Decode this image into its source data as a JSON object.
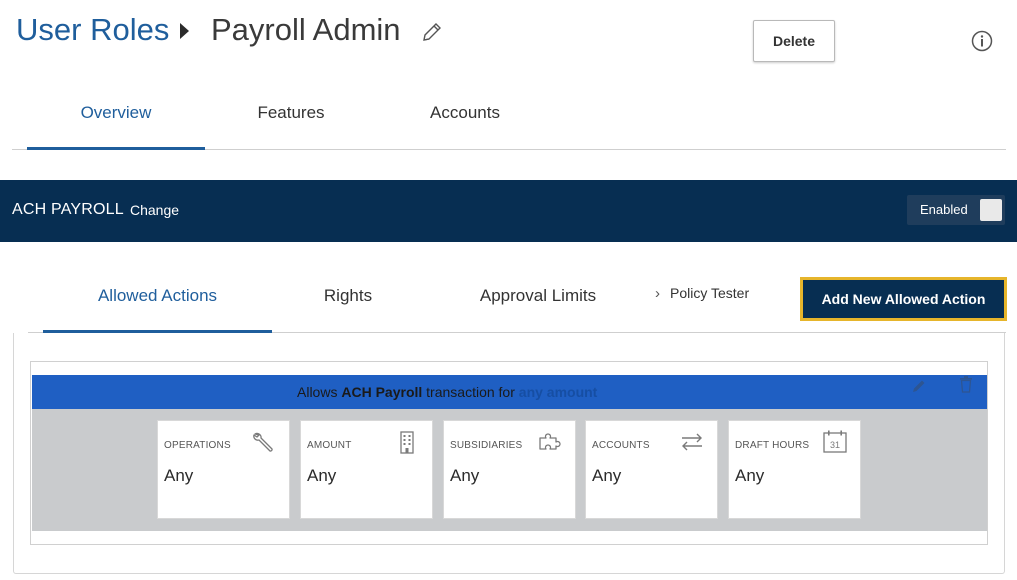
{
  "header": {
    "breadcrumb_root": "User Roles",
    "title": "Payroll Admin",
    "delete_label": "Delete"
  },
  "top_tabs": [
    {
      "label": "Overview",
      "active": true
    },
    {
      "label": "Features",
      "active": false
    },
    {
      "label": "Accounts",
      "active": false
    }
  ],
  "band": {
    "title": "ACH PAYROLL",
    "change_label": "Change",
    "toggle_label": "Enabled"
  },
  "sub_tabs": [
    {
      "label": "Allowed Actions",
      "active": true
    },
    {
      "label": "Rights",
      "active": false
    },
    {
      "label": "Approval Limits",
      "active": false
    }
  ],
  "policy_tester_label": "Policy Tester",
  "add_button_label": "Add New Allowed Action",
  "rule": {
    "prefix": "Allows ",
    "transaction": "ACH Payroll",
    "middle": " transaction for ",
    "amount": "any amount"
  },
  "cards": [
    {
      "label": "OPERATIONS",
      "value": "Any",
      "icon": "wrench-icon"
    },
    {
      "label": "AMOUNT",
      "value": "Any",
      "icon": "building-icon"
    },
    {
      "label": "SUBSIDIARIES",
      "value": "Any",
      "icon": "puzzle-icon"
    },
    {
      "label": "ACCOUNTS",
      "value": "Any",
      "icon": "transfer-arrows-icon"
    },
    {
      "label": "DRAFT HOURS",
      "value": "Any",
      "icon": "calendar-icon"
    }
  ],
  "calendar_day": "31",
  "colors": {
    "link_blue": "#1f5e9c",
    "band_navy": "#072e52",
    "rule_header_blue": "#1f5fc3",
    "button_outline_gold": "#e6b52b"
  }
}
